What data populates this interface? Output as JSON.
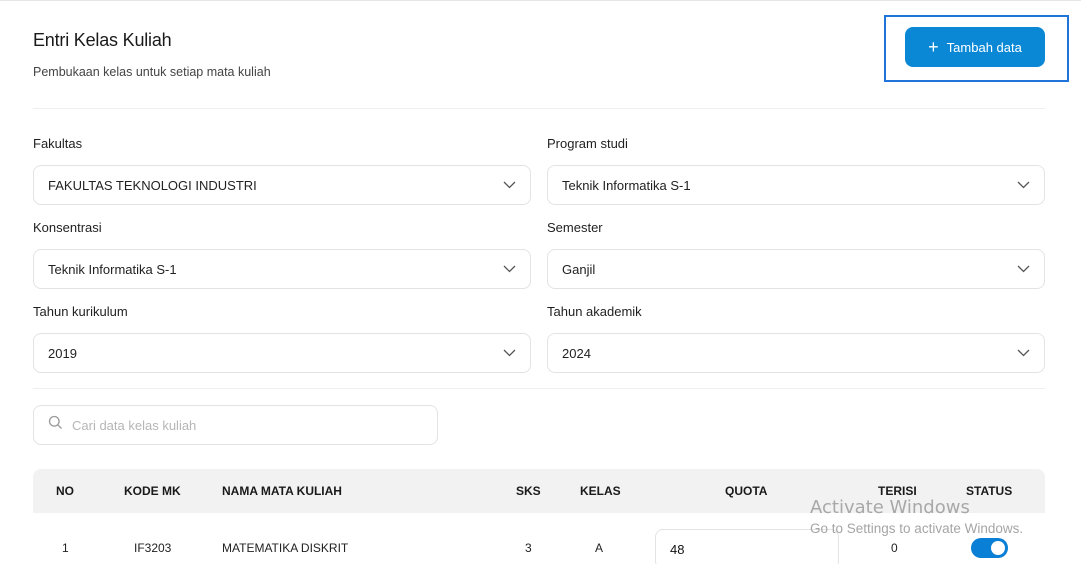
{
  "header": {
    "title": "Entri Kelas Kuliah",
    "subtitle": "Pembukaan kelas untuk setiap mata kuliah",
    "add_button_label": "Tambah data"
  },
  "filters": {
    "fakultas": {
      "label": "Fakultas",
      "value": "FAKULTAS TEKNOLOGI INDUSTRI"
    },
    "program_studi": {
      "label": "Program studi",
      "value": "Teknik Informatika S-1"
    },
    "konsentrasi": {
      "label": "Konsentrasi",
      "value": "Teknik Informatika S-1"
    },
    "semester": {
      "label": "Semester",
      "value": "Ganjil"
    },
    "tahun_kurikulum": {
      "label": "Tahun kurikulum",
      "value": "2019"
    },
    "tahun_akademik": {
      "label": "Tahun akademik",
      "value": "2024"
    }
  },
  "search": {
    "placeholder": "Cari data kelas kuliah"
  },
  "table": {
    "headers": {
      "no": "NO",
      "kode_mk": "KODE MK",
      "nama_mata_kuliah": "NAMA MATA KULIAH",
      "sks": "SKS",
      "kelas": "KELAS",
      "quota": "QUOTA",
      "terisi": "TERISI",
      "status": "STATUS"
    },
    "rows": [
      {
        "no": "1",
        "kode_mk": "IF3203",
        "nama_mata_kuliah": "MATEMATIKA DISKRIT",
        "sks": "3",
        "kelas": "A",
        "quota": "48",
        "terisi": "0",
        "status_on": true
      }
    ]
  },
  "watermark": {
    "title": "Activate Windows",
    "subtitle": "Go to Settings to activate Windows."
  },
  "colors": {
    "primary": "#0a88d6",
    "highlight": "#1e74d8",
    "toggle_on": "#0a7fd6"
  }
}
